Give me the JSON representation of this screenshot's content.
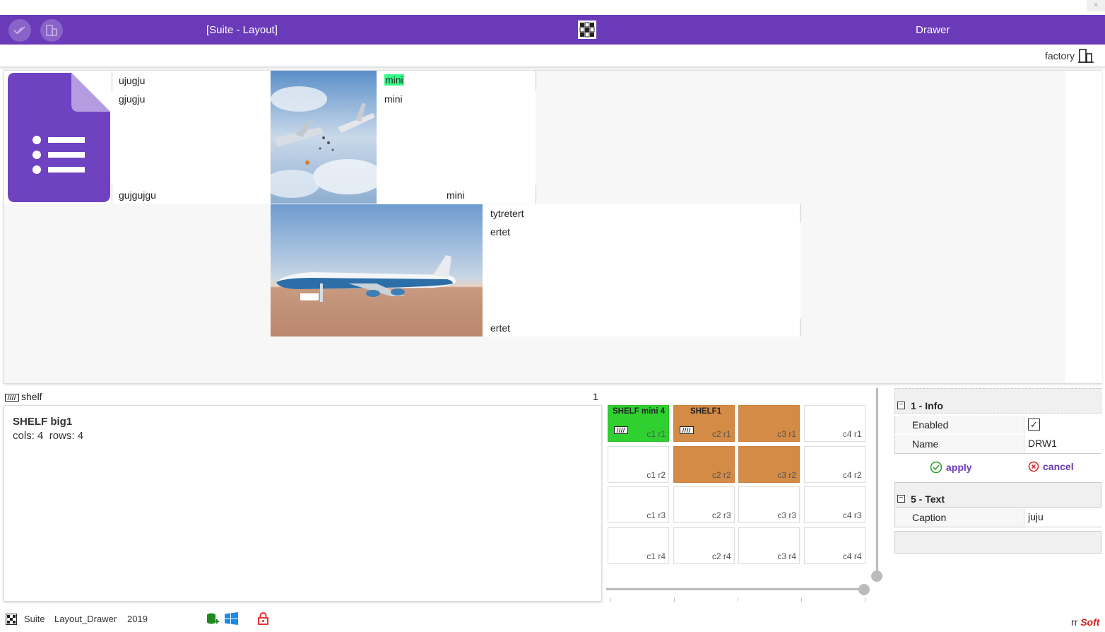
{
  "window": {
    "close_label": "×"
  },
  "titlebar": {
    "left_title": "[Suite - Layout]",
    "right_title": "Drawer",
    "grid_icon": "grid-icon",
    "check_icon": "double-check-icon",
    "device_icon": "devices-icon"
  },
  "subbar": {
    "factory_label": "factory",
    "factory_icon": "devices-icon"
  },
  "drawer": {
    "block1": {
      "lines_top": [
        "ujugju",
        "gjugju"
      ],
      "line_bottom": "gujgujgu",
      "icon": "forms-list-icon"
    },
    "block2": {
      "lines_top": [
        "mini",
        "mini"
      ],
      "line_bottom": "mini",
      "image": "plane-explosion-image"
    },
    "block3": {
      "lines_top": [
        "tytretert",
        "ertet"
      ],
      "line_bottom": "ertet",
      "image": "air-force-one-image"
    }
  },
  "shelf": {
    "header_label": "shelf",
    "header_count": "1",
    "title": "SHELF big1",
    "cols_label": "cols: 4",
    "rows_label": "rows: 4",
    "cells": [
      {
        "label": "c1 r1",
        "title": "SHELF mini 4",
        "style": "green",
        "badge": true
      },
      {
        "label": "c2 r1",
        "title": "SHELF1",
        "style": "orange",
        "badge": true
      },
      {
        "label": "c3 r1",
        "title": "",
        "style": "orange",
        "badge": false
      },
      {
        "label": "c4 r1",
        "title": "",
        "style": "white",
        "badge": false
      },
      {
        "label": "c1 r2",
        "title": "",
        "style": "white",
        "badge": false
      },
      {
        "label": "c2 r2",
        "title": "",
        "style": "orange",
        "badge": false
      },
      {
        "label": "c3 r2",
        "title": "",
        "style": "orange",
        "badge": false
      },
      {
        "label": "c4 r2",
        "title": "",
        "style": "white",
        "badge": false
      },
      {
        "label": "c1 r3",
        "title": "",
        "style": "white",
        "badge": false
      },
      {
        "label": "c2 r3",
        "title": "",
        "style": "white",
        "badge": false
      },
      {
        "label": "c3 r3",
        "title": "",
        "style": "white",
        "badge": false
      },
      {
        "label": "c4 r3",
        "title": "",
        "style": "white",
        "badge": false
      },
      {
        "label": "c1 r4",
        "title": "",
        "style": "white",
        "badge": false
      },
      {
        "label": "c2 r4",
        "title": "",
        "style": "white",
        "badge": false
      },
      {
        "label": "c3 r4",
        "title": "",
        "style": "white",
        "badge": false
      },
      {
        "label": "c4 r4",
        "title": "",
        "style": "white",
        "badge": false
      }
    ]
  },
  "props": {
    "info_header": "1 - Info",
    "enabled_label": "Enabled",
    "enabled_value": true,
    "name_label": "Name",
    "name_value": "DRW1",
    "apply_label": "apply",
    "cancel_label": "cancel",
    "text_header": "5 - Text",
    "caption_label": "Caption",
    "caption_value": "juju",
    "toggle_symbol": "−",
    "accent": "#6a3ab8",
    "apply_color": "#2e9e2e",
    "cancel_color": "#d02020"
  },
  "footer": {
    "app": "Suite",
    "layout": "Layout_Drawer",
    "year": "2019",
    "brand_prefix": "rr",
    "brand_suffix": "Soft",
    "db_icon": "database-add-icon",
    "windows_icon": "windows-icon",
    "lock_icon": "lock-icon"
  }
}
